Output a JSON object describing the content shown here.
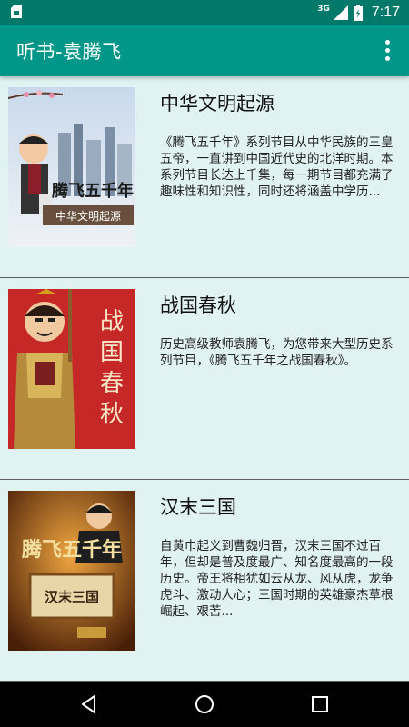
{
  "status_bar": {
    "time": "7:17",
    "network": "3G",
    "icons": [
      "sim-card-icon",
      "signal-icon",
      "battery-icon"
    ]
  },
  "app_bar": {
    "title": "听书-袁腾飞",
    "overflow_icon": "more-vert-icon"
  },
  "list": {
    "items": [
      {
        "title": "中华文明起源",
        "description": "《腾飞五千年》系列节目从中华民族的三皇五帝，一直讲到中国近代史的北洋时期。本系列节目长达上千集，每一期节目都充满了趣味性和知识性，同时还将涵盖中学历...",
        "cover_text": "腾飞五千年",
        "cover_subtext": "中华文明起源"
      },
      {
        "title": "战国春秋",
        "description": "历史高级教师袁腾飞，为您带来大型历史系列节目，《腾飞五千年之战国春秋》。",
        "cover_text": "战国春秋"
      },
      {
        "title": "汉末三国",
        "description": "自黄巾起义到曹魏归晋，汉末三国不过百年，但却是普及度最广、知名度最高的一段历史。帝王将相犹如云从龙、风从虎，龙争虎斗、激动人心；三国时期的英雄豪杰草根崛起、艰苦...",
        "cover_text": "腾飞五千年",
        "cover_subtext": "汉末三国"
      }
    ]
  },
  "nav_bar": {
    "back_icon": "back-icon",
    "home_icon": "home-icon",
    "recents_icon": "recents-icon"
  },
  "colors": {
    "primary": "#009688",
    "primary_dark": "#00796b",
    "background": "#e0f2f1"
  }
}
